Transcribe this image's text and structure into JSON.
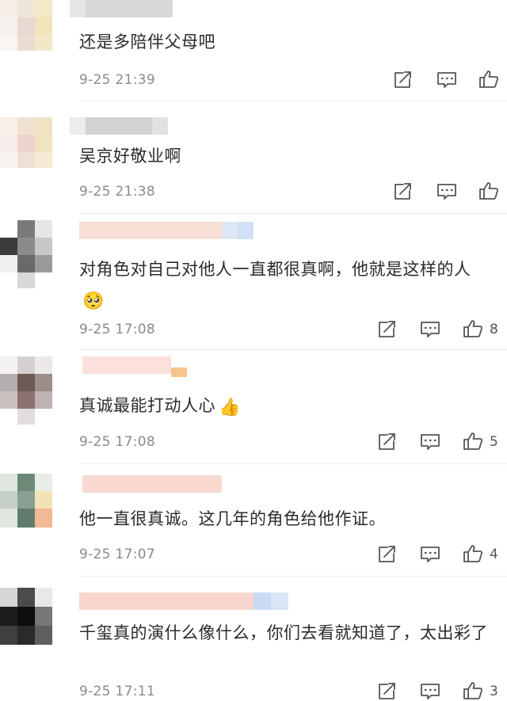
{
  "comments": [
    {
      "text": "还是多陪伴父母吧",
      "emoji": "",
      "time": "9-25 21:39",
      "likes": ""
    },
    {
      "text": "吴京好敬业啊",
      "emoji": "",
      "time": "9-25 21:38",
      "likes": ""
    },
    {
      "text": "对角色对自己对他人一直都很真啊，他就是这样的人",
      "emoji": "🥺",
      "time": "9-25 17:08",
      "likes": "8"
    },
    {
      "text": "真诚最能打动人心",
      "emoji": "👍",
      "time": "9-25 17:08",
      "likes": "5"
    },
    {
      "text": "他一直很真诚。这几年的角色给他作证。",
      "emoji": "",
      "time": "9-25 17:07",
      "likes": "4"
    },
    {
      "text": "千玺真的演什么像什么，你们去看就知道了，太出彩了",
      "emoji": "",
      "time": "9-25 17:11",
      "likes": "3"
    }
  ],
  "icons": {
    "share": "share-icon",
    "reply": "comment-icon",
    "like": "thumbs-up-icon"
  },
  "colors": {
    "text": "#2b2b2b",
    "time": "#8a8a8a",
    "icon": "#555555",
    "divider": "#ececec"
  }
}
